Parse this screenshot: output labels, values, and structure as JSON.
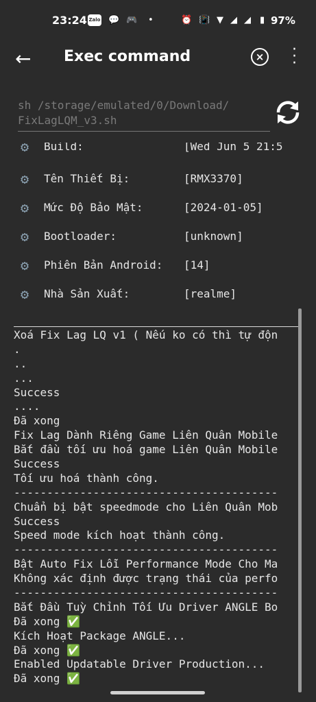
{
  "status_bar": {
    "time": "23:24",
    "zalo_label": "Zalo",
    "battery": "97%"
  },
  "app_bar": {
    "title": "Exec command"
  },
  "command": {
    "line1": "sh /storage/emulated/0/Download/",
    "line2": "FixLagLQM_v3.sh"
  },
  "device_info": [
    {
      "label": "Build:",
      "value": "[Wed Jun 5 21:5"
    },
    {
      "label": "Tên Thiết Bị:",
      "value": "[RMX3370]"
    },
    {
      "label": "Mức Độ Bảo Mật:",
      "value": "[2024-01-05]"
    },
    {
      "label": "Bootloader:",
      "value": "[unknown]"
    },
    {
      "label": "Phiên Bản Android:",
      "value": "[14]"
    },
    {
      "label": "Nhà Sản Xuất:",
      "value": "[realme]"
    }
  ],
  "log": [
    "Xoá Fix Lag LQ v1 ( Nếu ko có thì tự độn",
    ".",
    "..",
    "...",
    "Success",
    "....",
    "Đã xong",
    "Fix Lag Dành Riêng Game Liên Quân Mobile",
    "Bắt đầu tối ưu hoá game Liên Quân Mobile",
    "Success",
    "Tối ưu hoá thành công.",
    "----------------------------------------",
    "Chuẩn bị bật speedmode cho Liên Quân Mob",
    "Success",
    "Speed mode kích hoạt thành công.",
    "----------------------------------------",
    "Bật Auto Fix Lỗi Performance Mode Cho Ma",
    "Không xác định được trạng thái của perfo",
    "----------------------------------------",
    "Bắt Đầu Tuỳ Chỉnh Tối Ưu Driver ANGLE Bo",
    "Đã xong ✅",
    "Kích Hoạt Package ANGLE...",
    "Đã xong ✅",
    "Enabled Updatable Driver Production...",
    "Đã xong ✅"
  ]
}
